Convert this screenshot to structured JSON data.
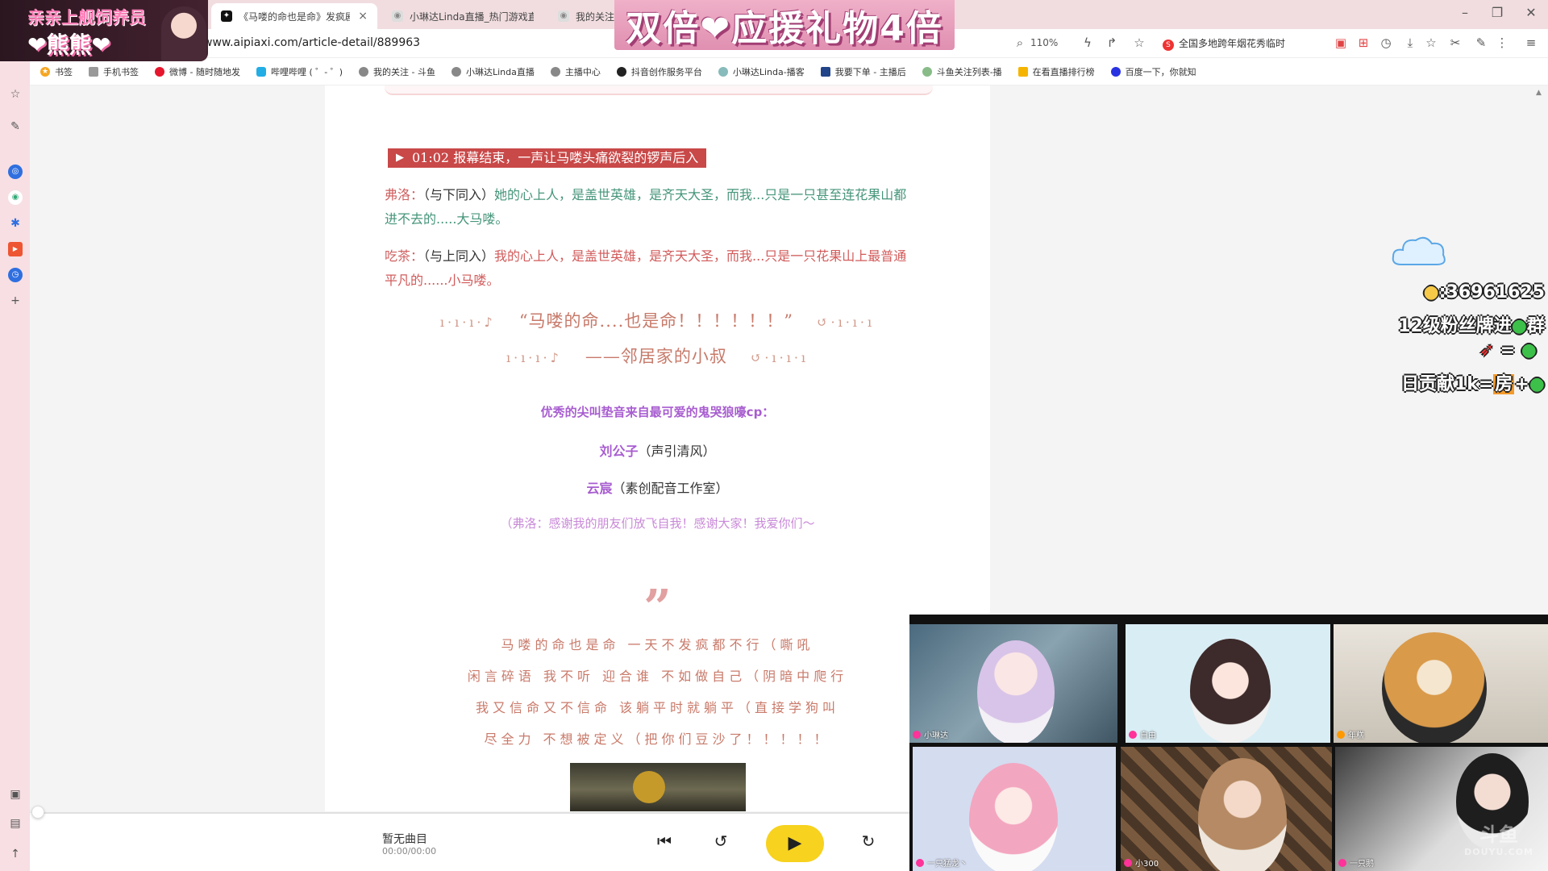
{
  "browser": {
    "tabs": [
      {
        "label": "《马喽的命也是命》发疯剧情",
        "active": true
      },
      {
        "label": "小琳达Linda直播_热门游戏直播",
        "active": false
      },
      {
        "label": "我的关注",
        "active": false
      }
    ],
    "close_glyph": "×",
    "url": "www.aipiaxi.com/article-detail/889963",
    "zoom": "110%",
    "news_ticker": "全国多地跨年烟花秀临时",
    "bookmarks": [
      "书签",
      "手机书签",
      "微博 - 随时随地发",
      "哔哩哔哩 ( ゜- ゜)",
      "我的关注 - 斗鱼",
      "小琳达Linda直播",
      "主播中心",
      "抖音创作服务平台",
      "小琳达Linda-播客",
      "我要下单 - 主播后",
      "斗鱼关注列表-播",
      "在看直播排行榜",
      "百度一下，你就知"
    ]
  },
  "overlays": {
    "logo_line1": "亲亲上舰饲养员",
    "logo_line2": "❤熊熊❤",
    "promo": "双倍❤应援礼物4倍",
    "fan_id": ":36961625",
    "fan_line2": "12级粉丝牌进",
    "fan_line2_suffix": "群",
    "fan_line3_eq": "=",
    "fan_line4_prefix": "日贡献1k",
    "fan_line4_eq": "=",
    "fan_line4_room": "房",
    "fan_line4_plus": "+"
  },
  "article": {
    "time_banner": "01:02 报幕结束，一声让马喽头痛欲裂的锣声后入",
    "dialog": [
      {
        "speaker": "弗洛：",
        "direction": "（与下同入）",
        "line1": "她的心上人，是盖世英雄，是齐天大圣，而我...只是一只甚至连花果山都",
        "line2": "进不去的.....大马喽。",
        "color": "green"
      },
      {
        "speaker": "吃茶：",
        "direction": "（与上同入）",
        "line1": "我的心上人，是盖世英雄，是齐天大圣，而我...只是一只花果山上最普通",
        "line2": "平凡的......小马喽。",
        "color": "red"
      }
    ],
    "quote_dots_left": "ı·ı·ı·♪",
    "quote_dots_right": "↺·ı·ı·ı",
    "quote1": "“马喽的命....也是命！！！！！！”",
    "quote2": "——邻居家的小叔",
    "credit_title": "优秀的尖叫垫音来自最可爱的鬼哭狼嚎cp：",
    "credits": [
      {
        "name": "刘公子",
        "note": "（声引清风）"
      },
      {
        "name": "云宸",
        "note": "（素创配音工作室）"
      }
    ],
    "thanks": "（弗洛：感谢我的朋友们放飞自我！感谢大家！我爱你们～",
    "quote_mark": "”",
    "lyrics": [
      "马喽的命也是命  一天不发疯都不行（嘶吼",
      "闲言碎语  我不听  迎合谁  不如做自己（阴暗中爬行",
      "我又信命又不信命  该躺平时就躺平（直接学狗叫",
      "尽全力  不想被定义（把你们豆沙了！！！！！"
    ]
  },
  "player": {
    "title": "暂无曲目",
    "time": "00:00/00:00",
    "progress": 0
  },
  "video_grid": {
    "cells": [
      "小琳达",
      "自由",
      "年糕",
      "一只猛龙丶",
      "小300",
      "一只鹅"
    ],
    "watermark": "斗鱼",
    "watermark_sub": "DOUYU.COM"
  },
  "colors": {
    "accent_red": "#c94848",
    "dialog_green": "#45957a",
    "dialog_red": "#d25a5a",
    "credit_purple": "#a85dd0",
    "play_yellow": "#f7d21e",
    "chrome_pink": "#f1dde0"
  }
}
